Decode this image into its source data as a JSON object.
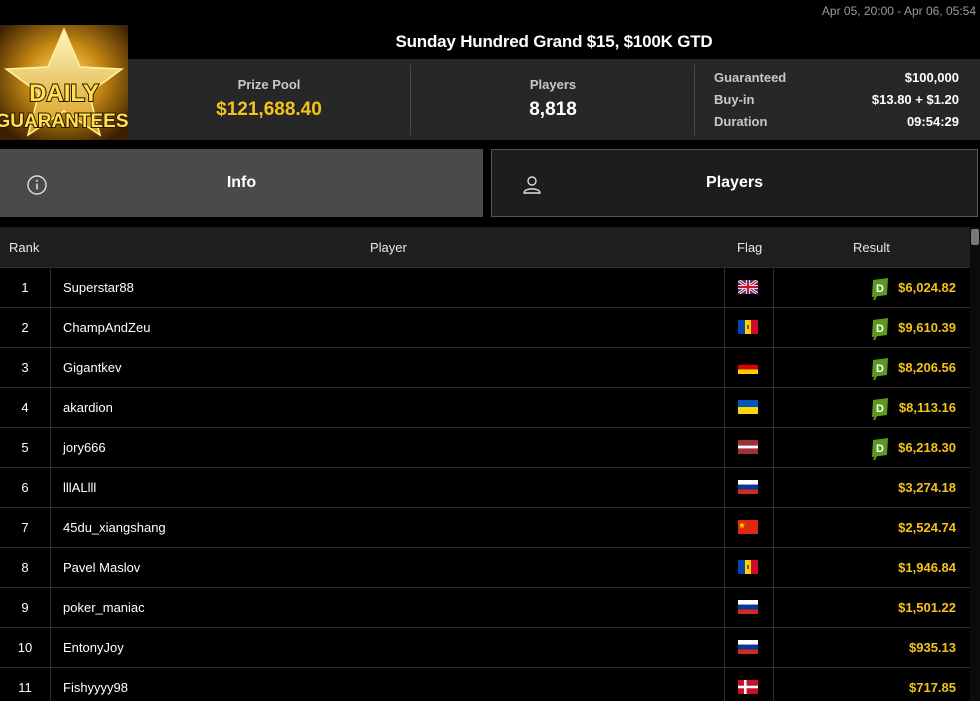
{
  "header": {
    "date_range": "Apr 05, 20:00 - Apr 06, 05:54",
    "logo": {
      "line1": "DAILY",
      "line2": "GUARANTEES"
    },
    "title": "Sunday Hundred Grand $15, $100K GTD"
  },
  "stats": {
    "prize_pool_label": "Prize Pool",
    "prize_pool_value": "$121,688.40",
    "players_label": "Players",
    "players_value": "8,818",
    "guaranteed_label": "Guaranteed",
    "guaranteed_value": "$100,000",
    "buyin_label": "Buy-in",
    "buyin_value": "$13.80 + $1.20",
    "duration_label": "Duration",
    "duration_value": "09:54:29"
  },
  "tabs": [
    {
      "label": "Info",
      "icon": "info-icon",
      "active": true
    },
    {
      "label": "Players",
      "icon": "user-icon",
      "active": false
    }
  ],
  "table": {
    "headers": {
      "rank": "Rank",
      "player": "Player",
      "flag": "Flag",
      "result": "Result"
    },
    "rows": [
      {
        "rank": "1",
        "player": "Superstar88",
        "flag": "gb",
        "result": "$6,024.82",
        "badge": "D"
      },
      {
        "rank": "2",
        "player": "ChampAndZeu",
        "flag": "md",
        "result": "$9,610.39",
        "badge": "D"
      },
      {
        "rank": "3",
        "player": "Gigantkev",
        "flag": "de",
        "result": "$8,206.56",
        "badge": "D"
      },
      {
        "rank": "4",
        "player": "akardion",
        "flag": "ua",
        "result": "$8,113.16",
        "badge": "D"
      },
      {
        "rank": "5",
        "player": "jory666",
        "flag": "lv",
        "result": "$6,218.30",
        "badge": "D"
      },
      {
        "rank": "6",
        "player": "lllALlll",
        "flag": "ru",
        "result": "$3,274.18",
        "badge": ""
      },
      {
        "rank": "7",
        "player": "45du_xiangshang",
        "flag": "cn",
        "result": "$2,524.74",
        "badge": ""
      },
      {
        "rank": "8",
        "player": "Pavel Maslov",
        "flag": "md",
        "result": "$1,946.84",
        "badge": ""
      },
      {
        "rank": "9",
        "player": "poker_maniac",
        "flag": "ru",
        "result": "$1,501.22",
        "badge": ""
      },
      {
        "rank": "10",
        "player": "EntonyJoy",
        "flag": "ru",
        "result": "$935.13",
        "badge": ""
      },
      {
        "rank": "11",
        "player": "Fishyyyy98",
        "flag": "dk",
        "result": "$717.85",
        "badge": ""
      }
    ]
  },
  "colors": {
    "gold": "#f2c318",
    "badge_green": "#5a9a1e"
  }
}
